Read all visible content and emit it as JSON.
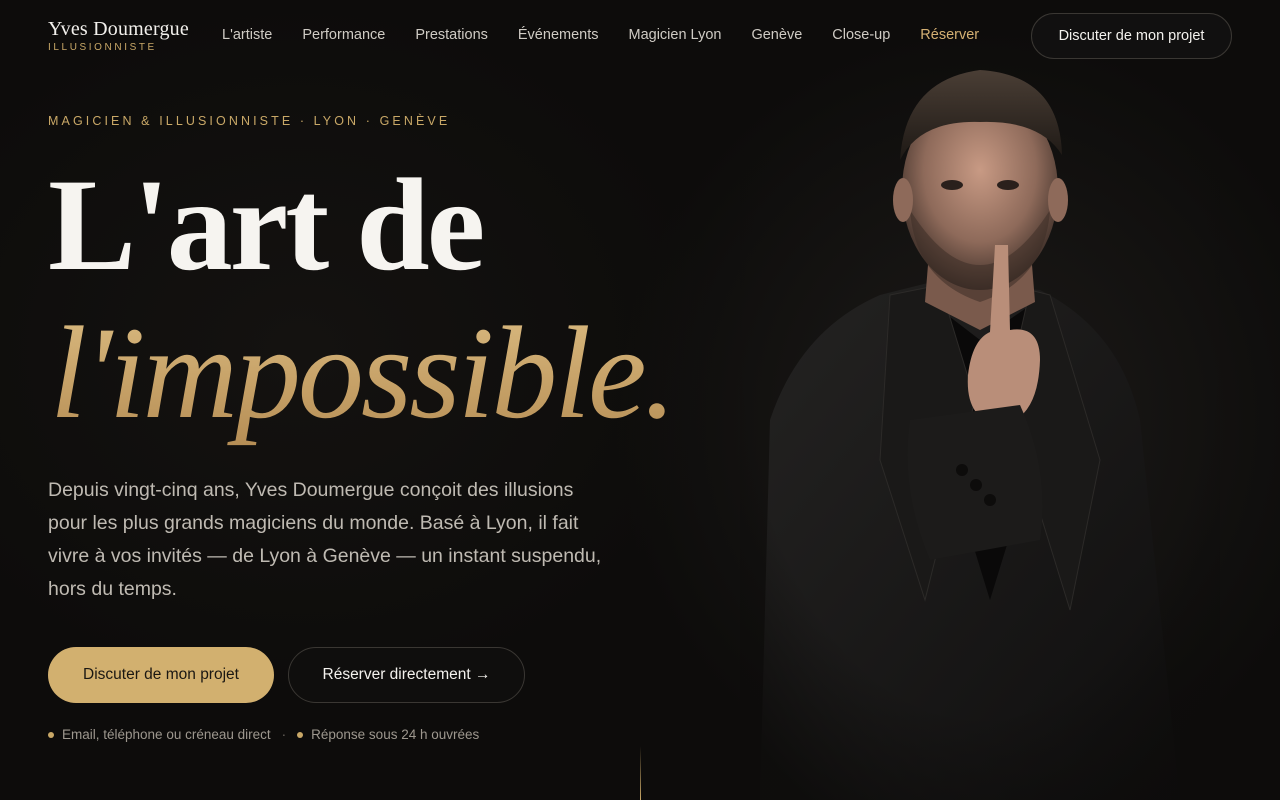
{
  "brand": {
    "name": "Yves Doumergue",
    "tagline": "ILLUSIONNISTE"
  },
  "nav": {
    "items": [
      {
        "label": "L'artiste"
      },
      {
        "label": "Performance"
      },
      {
        "label": "Prestations"
      },
      {
        "label": "Événements"
      },
      {
        "label": "Magicien Lyon"
      },
      {
        "label": "Genève"
      },
      {
        "label": "Close-up"
      },
      {
        "label": "Réserver",
        "active": true
      }
    ],
    "cta_label": "Discuter de mon projet"
  },
  "hero": {
    "eyebrow": "MAGICIEN & ILLUSIONNISTE · LYON · GENÈVE",
    "title_line1": "L'art de",
    "title_line2": "l'impossible.",
    "lead": "Depuis vingt-cinq ans, Yves Doumergue conçoit des illusions pour les plus grands magiciens du monde. Basé à Lyon, il fait vivre à vos invités — de Lyon à Genève — un instant suspendu, hors du temps.",
    "primary_cta": "Discuter de mon projet",
    "secondary_cta": "Réserver directement →",
    "meta": [
      "Email, téléphone ou créneau direct",
      "Réponse sous 24 h ouvrées"
    ],
    "meta_separator": "·"
  },
  "colors": {
    "accent": "#c9a867",
    "background": "#0d0c0b",
    "primary_button": "#d2b06f"
  },
  "icons": {
    "portrait": "magician-portrait-silhouette"
  }
}
